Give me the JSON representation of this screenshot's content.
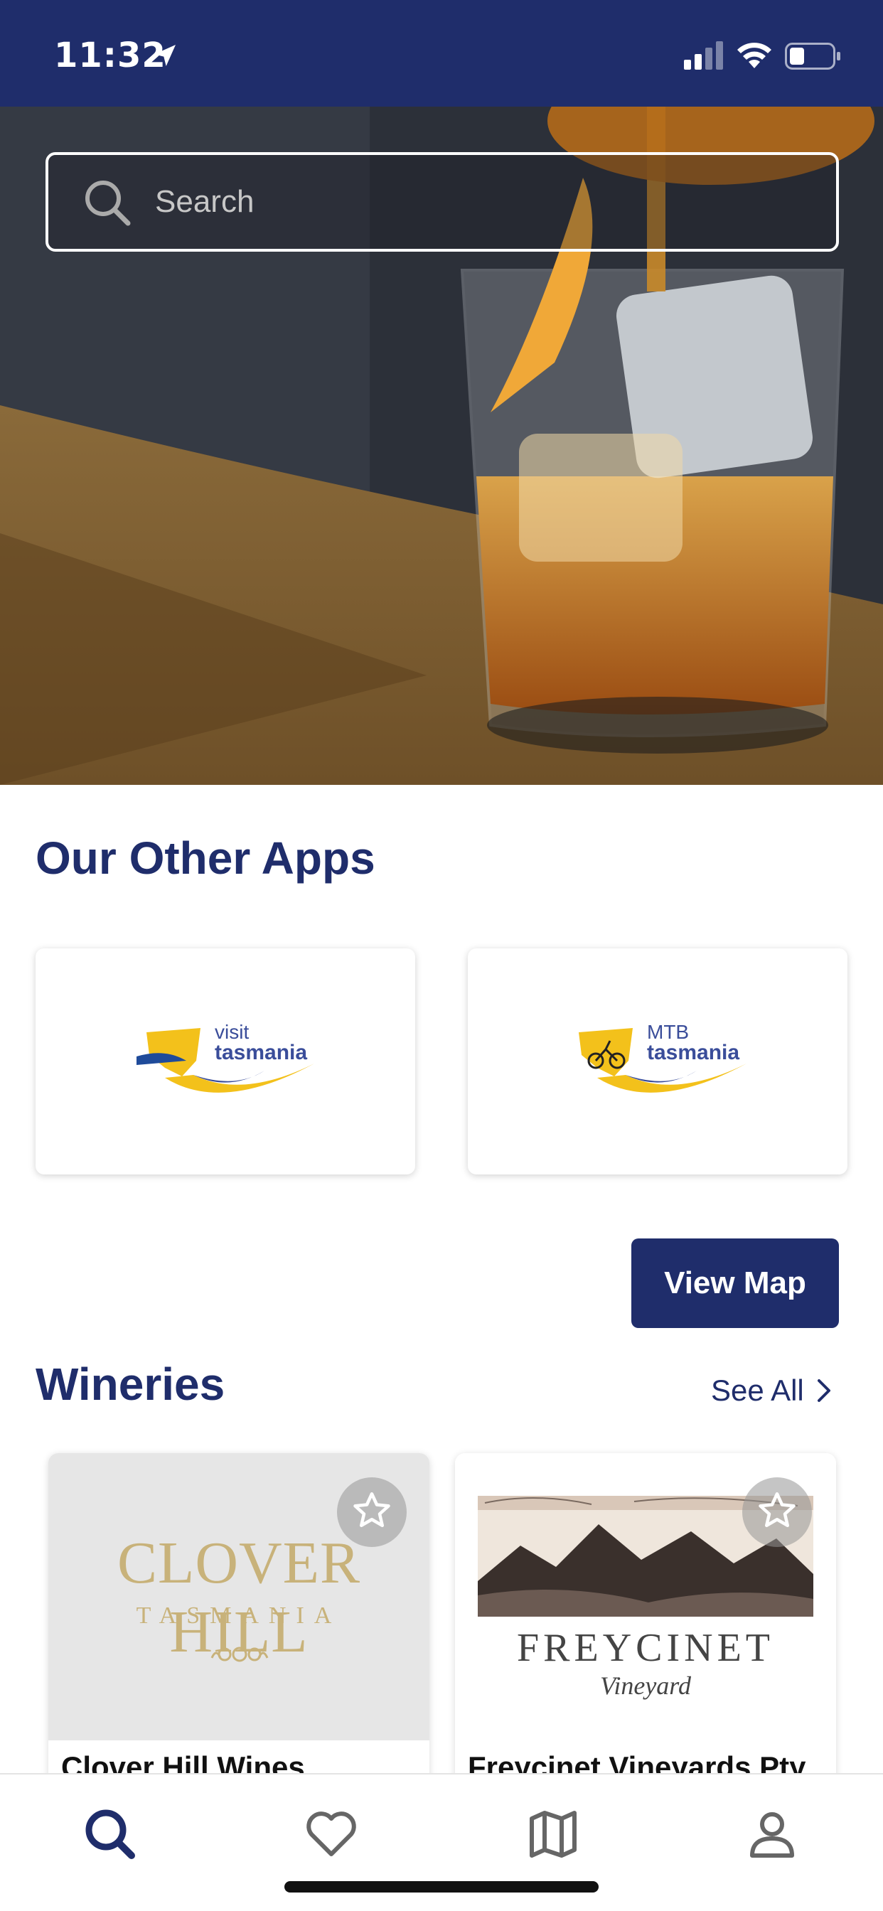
{
  "status_bar": {
    "time": "11:32",
    "icons": [
      "location-arrow-icon",
      "cellular-signal-icon",
      "wifi-icon",
      "battery-icon"
    ]
  },
  "hero": {
    "search": {
      "placeholder": "Search",
      "value": ""
    }
  },
  "other_apps": {
    "title": "Our Other Apps",
    "apps": [
      {
        "logo_line1": "visit",
        "logo_line2": "tasmania"
      },
      {
        "logo_line1": "MTB",
        "logo_line2": "tasmania"
      }
    ]
  },
  "view_map_label": "View Map",
  "wineries": {
    "title": "Wineries",
    "see_all_label": "See All",
    "items": [
      {
        "name": "Clover Hill Wines",
        "logo_main": "CLOVER HILL",
        "logo_sub": "TASMANIA"
      },
      {
        "name": "Freycinet Vineyards Pty",
        "logo_main": "FREYCINET",
        "logo_sub": "Vineyard"
      }
    ]
  },
  "tab_bar": {
    "tabs": [
      "search-icon",
      "heart-icon",
      "map-icon",
      "profile-icon"
    ],
    "active": "search-icon"
  },
  "colors": {
    "brand_navy": "#1f2d6b",
    "logo_yellow": "#f3c11b",
    "logo_blue": "#3a4d9a",
    "clover_gold": "#c8b27a"
  }
}
